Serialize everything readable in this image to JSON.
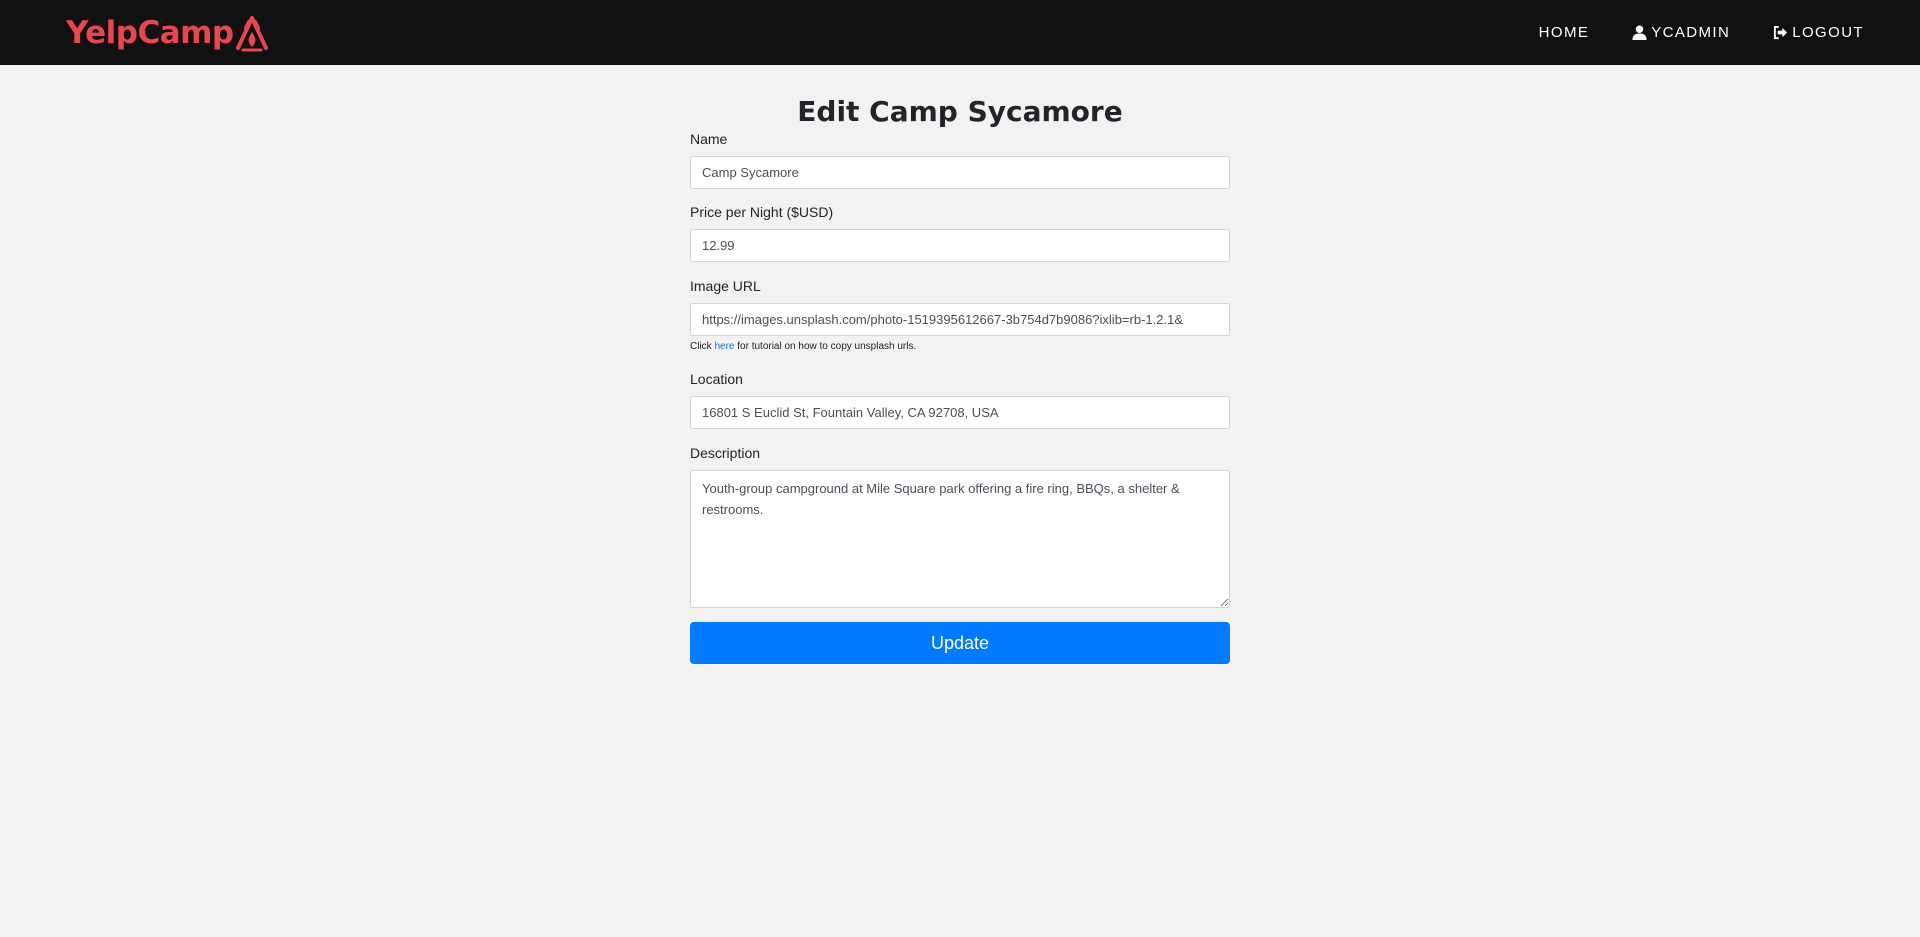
{
  "navbar": {
    "brand": "YelpCamp",
    "links": [
      {
        "label": "HOME",
        "icon": ""
      },
      {
        "label": "YCADMIN",
        "icon": "user-icon"
      },
      {
        "label": "LOGOUT",
        "icon": "sign-out-icon"
      }
    ]
  },
  "colors": {
    "brand": "#e8474d",
    "navbar_bg": "#111111",
    "page_bg": "#f2f2f2",
    "primary_button": "#007bff",
    "link": "#1f73c7"
  },
  "form": {
    "title": "Edit Camp Sycamore",
    "name_label": "Name",
    "name_value": "Camp Sycamore",
    "price_label": "Price per Night ($USD)",
    "price_value": "12.99",
    "image_label": "Image URL",
    "image_value": "https://images.unsplash.com/photo-1519395612667-3b754d7b9086?ixlib=rb-1.2.1&",
    "help_prefix": "Click ",
    "help_link": "here",
    "help_suffix": " for tutorial on how to copy unsplash urls.",
    "location_label": "Location",
    "location_value": "16801 S Euclid St, Fountain Valley, CA 92708, USA",
    "description_label": "Description",
    "description_value": "Youth-group campground at Mile Square park offering a fire ring, BBQs, a shelter & restrooms.",
    "submit_label": "Update"
  }
}
